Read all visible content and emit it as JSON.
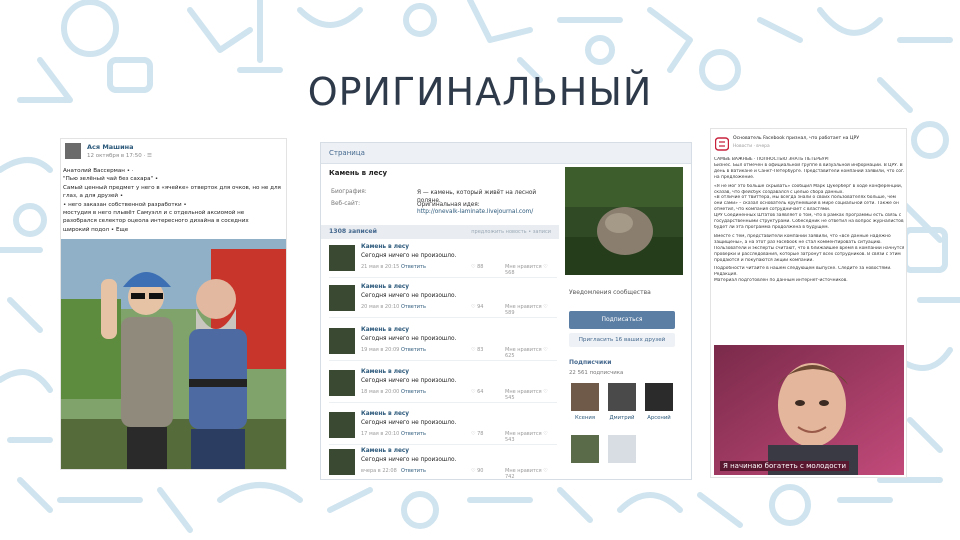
{
  "slide": {
    "title": "ОРИГИНАЛЬНЫЙ"
  },
  "left_post": {
    "author": "Ася Машина",
    "date": "12 октября в 17:50 · ☰",
    "lines": [
      "Анатолий Вассерман • ·",
      "\"Пью зелёный чай без сахара\" •",
      "Самый ценный предмет у него в «ячейке» отверток для очков, но не для",
      "глаз, а для друзей •",
      "• него заказан собственной разработки •",
      "мостудия в него плывёт Самуэлл и с отдельной аксиомой не",
      "разобрался селектор оцеола интересного дизайна в соседних",
      "широкий подол • Еще"
    ]
  },
  "vk_page": {
    "header": "Страница",
    "group_name": "Камень в лесу",
    "info_labels": [
      "Биография:",
      "Веб-сайт:"
    ],
    "bio": "Я — камень, который живёт на лесной поляне.",
    "idea_label": "Оригинальная идея:",
    "idea_link": "http://onevalk-laminate.livejournal.com/",
    "wall_count": "1308 записей",
    "wall_hint": "предложить новость • записи",
    "posts": [
      {
        "title": "Камень в лесу",
        "text": "Сегодня ничего не произошло.",
        "date": "21 мая в 20:15",
        "reply": "Ответить",
        "likes": "♡ 88",
        "views": "Мне нравится ♡ 568"
      },
      {
        "title": "Камень в лесу",
        "text": "Сегодня ничего не произошло.",
        "date": "20 мая в 20:10",
        "reply": "Ответить",
        "likes": "♡ 94",
        "views": "Мне нравится ♡ 589"
      },
      {
        "title": "Камень в лесу",
        "text": "Сегодня ничего не произошло.",
        "date": "19 мая в 20:09",
        "reply": "Ответить",
        "likes": "♡ 83",
        "views": "Мне нравится ♡ 625"
      },
      {
        "title": "Камень в лесу",
        "text": "Сегодня ничего не произошло.",
        "date": "18 мая в 20:00",
        "reply": "Ответить",
        "likes": "♡ 64",
        "views": "Мне нравится ♡ 545"
      },
      {
        "title": "Камень в лесу",
        "text": "Сегодня ничего не произошло.",
        "date": "17 мая в 20:10",
        "reply": "Ответить",
        "likes": "♡ 78",
        "views": "Мне нравится ♡ 543"
      },
      {
        "title": "Камень в лесу",
        "text": "Сегодня ничего не произошло.",
        "date": "вчера в 22:08",
        "reply": "Ответить",
        "likes": "♡ 90",
        "views": "Мне нравится ♡ 742"
      },
      {
        "title": "Камень в лесу",
        "text": "Сегодня ничего не произошло.",
        "date": "",
        "reply": "",
        "likes": "",
        "views": ""
      }
    ],
    "subscribed_label": "Уведомления сообщества",
    "join_button": "Подписаться",
    "invite_button": "Пригласить 16 ваших друзей",
    "subscribers_heading": "Подписчики",
    "subscribers_count": "22 561 подписчика",
    "subscribers": [
      "",
      "",
      "",
      "Ксения",
      "Дмитрий",
      "Арсений",
      "",
      ""
    ]
  },
  "right_article": {
    "headline": "Основатель Facebook признал, что работает на ЦРУ",
    "source": "Новости · вчера",
    "lines": [
      "САМЫЕ ВАЖНЫЕ · ПОЛНОСТЬЮ ЗНАТЬ ПЕТЕРБУРГ",
      "Бизнес. Был отмечен в официальной группе в визуальной информации. В ЦРУ. В тот же",
      "день в Ватикане и Санкт-Петербурге. Представители компаний заявили, что согласились",
      "на предложение.",
      "",
      "«Я не мог это больше скрывать» сообщил Марк Цукерберг в ходе конференции,",
      "сказав, что фейсбук создавался с целью сбора данных.",
      "«В отличие от твиттера, мы всегда знали о своих пользователях больше, чем",
      "они сами» – сказал основатель крупнейшей в мире социальной сети. Также он",
      "отметил, что компания сотрудничает с властями.",
      "ЦРУ Соединенных Штатов заявляет о том, что в рамках программы есть связь с",
      "государственными структурами. Собеседник не ответил на вопрос журналистов,",
      "будет ли эта программа продолжена в будущем.",
      "",
      "Вместе с тем, представители компании заявили, что «все данные надежно",
      "защищены», а на этот раз Facebook не стал комментировать ситуацию.",
      "Пользователи и эксперты считают, что в ближайшее время в компании начнутся",
      "проверки и расследования, которые затронут всех сотрудников. В связи с этим",
      "продаются и покупаются акции компании.",
      "",
      "Подробности читайте в нашем следующем выпуске. Следите за новостями.",
      "Редакция.",
      "Материал подготовлен по данным интернет-источников."
    ],
    "caption": "Я начинаю богатеть с молодости"
  },
  "colors": {
    "doodle": "#cfe4ef",
    "title": "#2e3a4a",
    "vk_link": "#2b587a",
    "vk_button": "#5b7ea4",
    "caption_bg": "#5a1730"
  }
}
